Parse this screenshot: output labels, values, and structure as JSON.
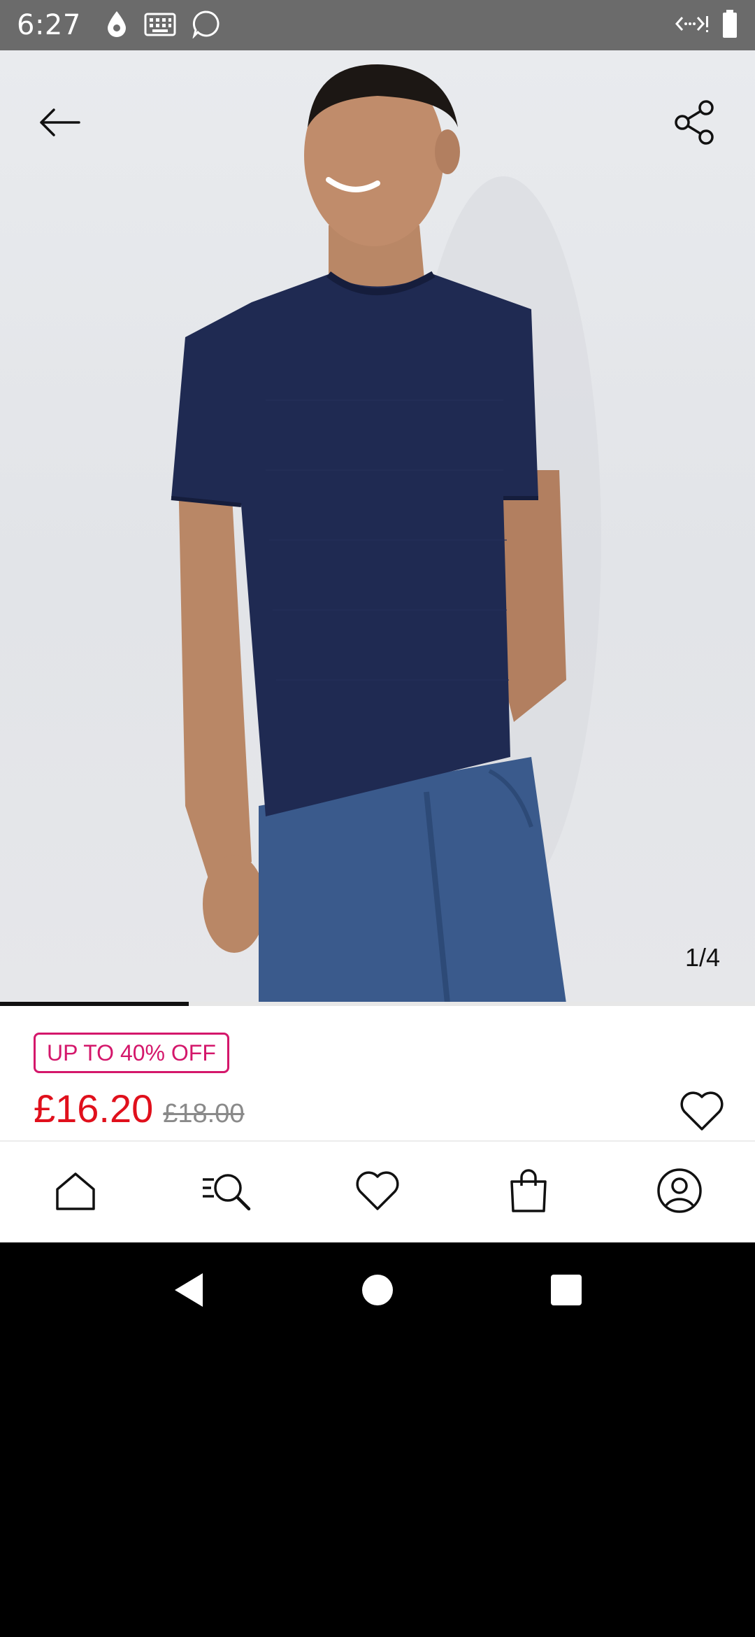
{
  "status_bar": {
    "time": "6:27"
  },
  "product": {
    "image_counter": "1/4",
    "image_progress": 0.25,
    "promo_badge": "UP TO 40% OFF",
    "price_now": "£16.20",
    "price_was": "£18.00"
  },
  "icons": {
    "back": "arrow-left-icon",
    "share": "share-icon",
    "wishlist": "heart-icon"
  },
  "bottom_nav": {
    "items": [
      {
        "name": "home",
        "icon": "home-icon"
      },
      {
        "name": "search",
        "icon": "search-icon"
      },
      {
        "name": "wishlist",
        "icon": "heart-icon"
      },
      {
        "name": "bag",
        "icon": "bag-icon"
      },
      {
        "name": "account",
        "icon": "user-icon"
      }
    ]
  },
  "colors": {
    "promo": "#d4176b",
    "price_now": "#e0101c",
    "price_was": "#8a8a8a",
    "tshirt": "#1f2a52",
    "jeans": "#3a5a8c"
  }
}
